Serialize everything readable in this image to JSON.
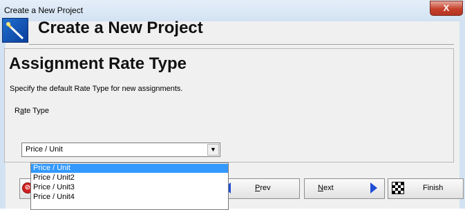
{
  "window": {
    "title": "Create a New Project",
    "close_label": "X"
  },
  "header": {
    "title": "Create a New Project",
    "icon": "wizard-wand-icon"
  },
  "panel": {
    "title": "Assignment Rate Type",
    "description": "Specify the default Rate Type for new assignments.",
    "field_label_pre": "R",
    "field_label_ul": "a",
    "field_label_post": "te Type"
  },
  "select": {
    "value": "Price / Unit",
    "options": [
      "Price / Unit",
      "Price / Unit2",
      "Price / Unit3",
      "Price / Unit4"
    ],
    "selected_index": 0
  },
  "buttons": {
    "prev_ul": "P",
    "prev_rest": "rev",
    "next_ul": "N",
    "next_rest": "ext",
    "finish": "Finish"
  },
  "colors": {
    "accent": "#3399ff",
    "arrow": "#1f4fd6",
    "close": "#c5412c"
  }
}
